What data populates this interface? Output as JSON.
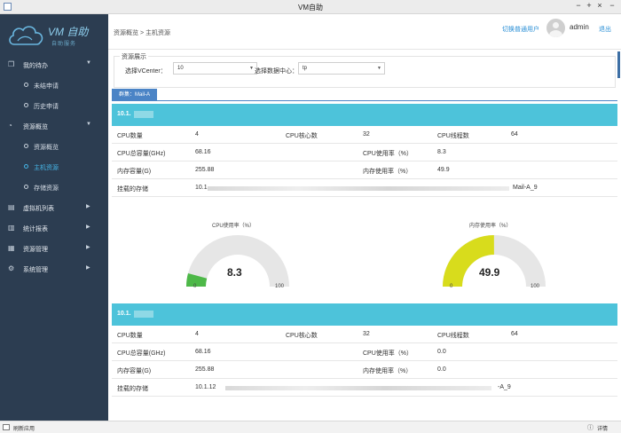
{
  "window": {
    "title": "VM自助",
    "controls": [
      "−",
      "+",
      "×",
      "−"
    ]
  },
  "logo": {
    "brand": "VM 自助",
    "sub": "自助服务"
  },
  "nav": {
    "my_tasks": "我的待办",
    "pending": "未结申请",
    "history": "历史申请",
    "resource_overview": "资源概览",
    "resource_overview_sub": "资源概览",
    "host_resources": "主机资源",
    "storage_resources": "存储资源",
    "vm_list": "虚拟机列表",
    "stats_report": "统计报表",
    "resource_mgmt": "资源管理",
    "system_mgmt": "系统管理"
  },
  "topbar": {
    "breadcrumb": "资源概览 > 主机资源",
    "switch_user": "切换普通用户",
    "username": "admin",
    "logout": "退出"
  },
  "filter": {
    "legend": "资源展示",
    "vcenter_label": "选择VCenter：",
    "vcenter_value": "10",
    "datacenter_label": "选择数据中心：",
    "datacenter_value": "tp"
  },
  "cluster_tab": "群集：Mail-A",
  "labels": {
    "cpu_count": "CPU数量",
    "cpu_cores": "CPU核心数",
    "cpu_threads": "CPU线程数",
    "cpu_capacity": "CPU总容量(GHz)",
    "cpu_usage": "CPU使用率（%）",
    "mem_capacity": "内存容量(G)",
    "mem_usage": "内存使用率（%）",
    "storage": "挂载的存储"
  },
  "gauge": {
    "cpu_title": "CPU使用率（%）",
    "mem_title": "内存使用率（%）",
    "min": "0",
    "max": "100"
  },
  "hosts": [
    {
      "ip": "10.1.",
      "cpu_count": "4",
      "cpu_cores": "32",
      "cpu_threads": "64",
      "cpu_capacity": "68.16",
      "cpu_usage": "8.3",
      "mem_capacity": "255.88",
      "mem_usage": "49.9",
      "storage_prefix": "10.1.",
      "storage_suffix": "Mail-A_9",
      "cpu_gauge_fraction": 0.083,
      "mem_gauge_fraction": 0.499,
      "cpu_gauge_text": "8.3",
      "mem_gauge_text": "49.9"
    },
    {
      "ip": "10.1.",
      "cpu_count": "4",
      "cpu_cores": "32",
      "cpu_threads": "64",
      "cpu_capacity": "68.16",
      "cpu_usage": "0.0",
      "mem_capacity": "255.88",
      "mem_usage": "0.0",
      "storage_prefix": "10.1.12",
      "storage_suffix": "-A_9"
    }
  ],
  "status": {
    "refresh": "刷新应用",
    "detail": "详情"
  },
  "colors": {
    "sidebar": "#2c3d51",
    "host_header": "#4dc3da",
    "cpu_gauge": "#4db848",
    "mem_gauge": "#d8dc1c",
    "accent": "#2a8fd6"
  }
}
